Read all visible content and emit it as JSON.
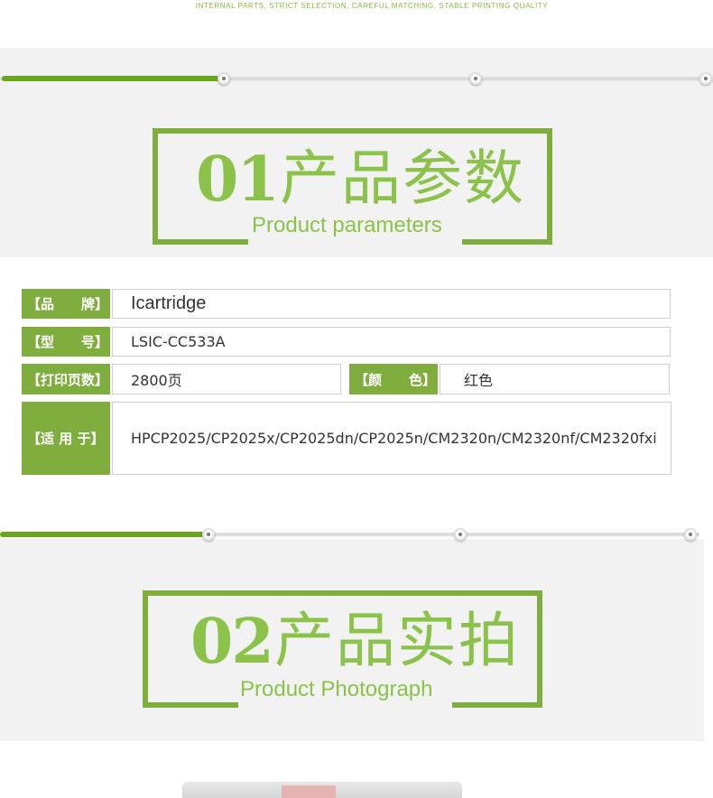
{
  "header": {
    "tagline": "INTERNAL PARTS, STRICT SELECTION, CAREFUL MATCHING, STABLE PRINTING QUALITY"
  },
  "theme": {
    "accent": "#7fad3e",
    "title_text": "#8bc34a",
    "progress_fill": "#6aa61b",
    "section_background": "#f2f2f2"
  },
  "section1": {
    "number": "01",
    "title_cn": "产品参数",
    "title_en": "Product parameters"
  },
  "params": {
    "brand_label": "【品　　牌】",
    "brand_value": "Icartridge",
    "model_label": "【型　　号】",
    "model_value": "LSIC-CC533A",
    "pages_label": "【打印页数】",
    "pages_value": "2800页",
    "color_label": "【颜　　色】",
    "color_value": "红色",
    "compat_label": "【适 用 于】",
    "compat_value": "HPCP2025/CP2025x/CP2025dn/CP2025n/CM2320n/CM2320nf/CM2320fxi"
  },
  "section2": {
    "number": "02",
    "title_cn": "产品实拍",
    "title_en": "Product Photograph"
  }
}
